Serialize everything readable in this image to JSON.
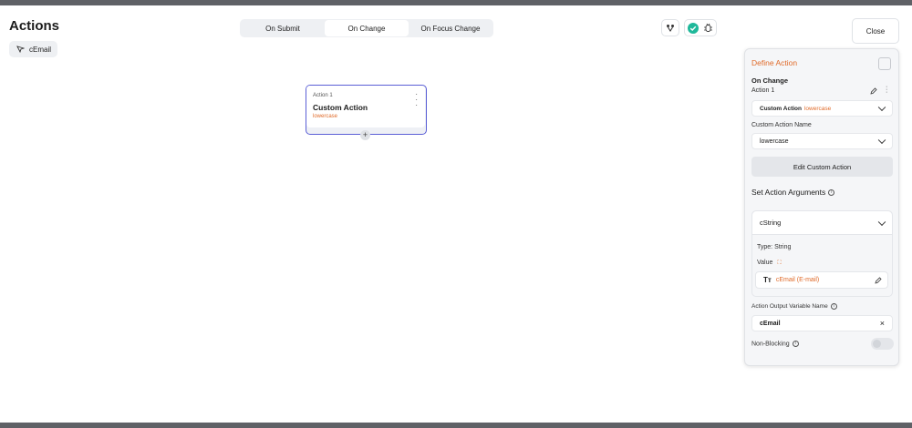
{
  "header": {
    "title": "Actions",
    "chip_label": "cEmail",
    "tabs": [
      "On Submit",
      "On Change",
      "On Focus Change"
    ],
    "active_tab": "On Change",
    "close_label": "Close"
  },
  "node": {
    "label": "Action 1",
    "title": "Custom Action",
    "subtitle": "lowercase"
  },
  "panel": {
    "title": "Define Action",
    "trigger": "On Change",
    "action_label": "Action 1",
    "action_type": "Custom Action",
    "action_type_value": "lowercase",
    "custom_action_name_label": "Custom Action Name",
    "custom_action_name_value": "lowercase",
    "edit_button": "Edit Custom Action",
    "args_heading": "Set Action Arguments",
    "arg_name": "cString",
    "arg_type": "Type: String",
    "value_label": "Value",
    "value_text": "cEmail (E-mail)",
    "output_label": "Action Output Variable Name",
    "output_value": "cEmail",
    "non_blocking_label": "Non-Blocking",
    "non_blocking_on": false
  },
  "colors": {
    "accent": "#e06b2a",
    "node_border": "#5b5fd6",
    "success": "#1fb89a"
  }
}
